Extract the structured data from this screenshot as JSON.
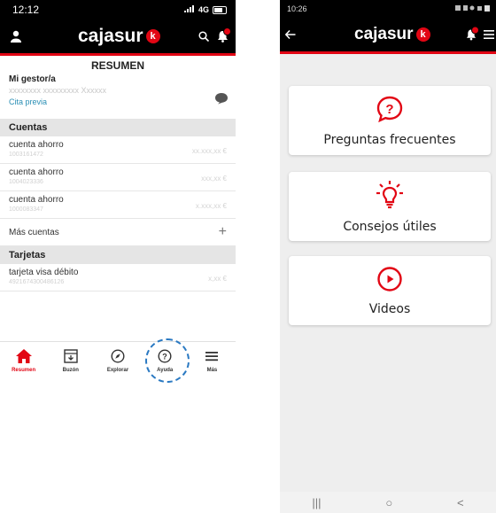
{
  "left_phone": {
    "status": {
      "time": "12:12",
      "network": "4G"
    },
    "header": {
      "brand": "cajasur",
      "brand_badge": "k"
    },
    "title": "RESUMEN",
    "gestor": {
      "label": "Mi gestor/a",
      "name": "xxxxxxxx xxxxxxxxx Xxxxxx",
      "cita_link": "Cita previa"
    },
    "cuentas": {
      "header": "Cuentas",
      "items": [
        {
          "label": "cuenta ahorro",
          "number": "1003161472",
          "amount": "xx.xxx,xx €"
        },
        {
          "label": "cuenta ahorro",
          "number": "1004023336",
          "amount": "xxx,xx €"
        },
        {
          "label": "cuenta ahorro",
          "number": "1000083347",
          "amount": "x.xxx,xx €"
        }
      ],
      "more_label": "Más cuentas",
      "more_icon": "+"
    },
    "tarjetas": {
      "header": "Tarjetas",
      "items": [
        {
          "label": "tarjeta visa débito",
          "number": "4921674300486126",
          "amount": "x,xx €"
        }
      ]
    },
    "tabbar": {
      "items": [
        {
          "label": "Resumen",
          "icon": "home-icon",
          "active": true
        },
        {
          "label": "Buzón",
          "icon": "inbox-icon",
          "active": false
        },
        {
          "label": "Explorar",
          "icon": "compass-icon",
          "active": false
        },
        {
          "label": "Ayuda",
          "icon": "help-circle-icon",
          "active": false
        },
        {
          "label": "Más",
          "icon": "menu-icon",
          "active": false
        }
      ]
    }
  },
  "right_phone": {
    "status": {
      "time": "10:26"
    },
    "header": {
      "brand": "cajasur",
      "brand_badge": "k"
    },
    "cards": [
      {
        "title": "Preguntas frecuentes",
        "icon": "question-bubble-icon"
      },
      {
        "title": "Consejos útiles",
        "icon": "lightbulb-icon"
      },
      {
        "title": "Videos",
        "icon": "play-circle-icon"
      }
    ],
    "nav": {
      "recent": "|||",
      "home": "○",
      "back": "<"
    }
  },
  "colors": {
    "brand_red": "#e20614",
    "header_bg": "#000000",
    "link_blue": "#2a8fb5",
    "highlight_blue": "#2a79c2"
  }
}
